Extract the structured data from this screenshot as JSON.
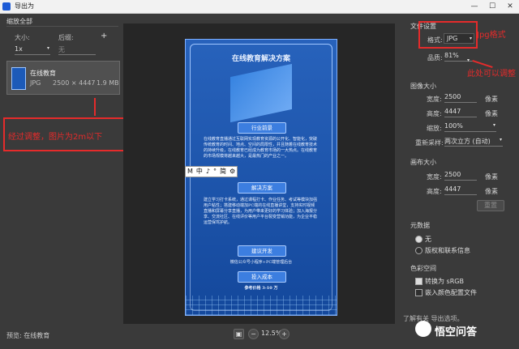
{
  "window": {
    "title": "导出为",
    "minimize": "—",
    "maximize": "☐",
    "close": "✕"
  },
  "left": {
    "scale_all_title": "缩放全部",
    "col_size": "大小:",
    "col_suffix": "后缀:",
    "plus": "+",
    "size_value": "1x",
    "suffix_placeholder": "无",
    "file": {
      "name": "在线教育",
      "format": "JPG",
      "dims": "2500 × 4447",
      "size": "1.9 MB"
    },
    "annotation": "经过调整，图片为2m以下",
    "preview_label": "预览: 在线教育"
  },
  "poster": {
    "title": "在线教育解决方案",
    "section1": "行业前景",
    "para1": "在线教育直播通过互联网实现教育资源的公开化、智能化，突破传统教育的时间、地点、空间的局限性，并且随着在线教育技术的持续升级，在线教育已经成为教育市场的一大热点。在线教育的市场规模将越来越大，是最热门的产业之一。",
    "section2": "解决方案",
    "para2": "建立学习打卡系统，通过课程打卡、作业任务、考试等模块加强用户粘性；搭建移动端加PC端的在线直播讲堂，支持实时视频直播和屏幕分享直播，为用户带来更好的学习体验；加入海报分享、交流社区、在线评价等用户平台裂变营销功能，为企业平稳运营保驾护航。",
    "section3": "建议开发",
    "para3": "微信公众号小程序+PC端管理后台",
    "section4": "投入成本",
    "para4": "参考价格 3-10 万"
  },
  "ime": {
    "items": [
      "M",
      "中",
      "♪",
      "°",
      "简",
      "⚙"
    ]
  },
  "zoom": {
    "value": "12.5%",
    "minus": "−",
    "plus": "+"
  },
  "right": {
    "file_settings_title": "文件设置",
    "format_label": "格式:",
    "format_value": "JPG",
    "quality_label": "品质:",
    "quality_value": "81%",
    "annotation_format": "Jpg格式",
    "annotation_quality": "此处可以调整",
    "image_size_title": "图像大小",
    "width_label": "宽度:",
    "width_value": "2500",
    "height_label": "高度:",
    "height_value": "4447",
    "unit_px": "像素",
    "scale_label": "缩放:",
    "scale_value": "100%",
    "resample_label": "重新采样:",
    "resample_value": "两次立方 (自动)",
    "canvas_size_title": "画布大小",
    "canvas_width_value": "2500",
    "canvas_height_value": "4447",
    "reset_label": "重置",
    "metadata_title": "元数据",
    "meta_none": "无",
    "meta_copyright": "版权和联系信息",
    "colorspace_title": "色彩空间",
    "convert_srgb": "转换为 sRGB",
    "embed_profile": "嵌入颜色配置文件",
    "learn_more": "了解有关 导出选项。"
  },
  "watermark": "悟空问答",
  "colors": {
    "accent_red": "#e52b2b",
    "poster_blue": "#1c5ab8",
    "panel_bg": "#3a3a3a"
  }
}
